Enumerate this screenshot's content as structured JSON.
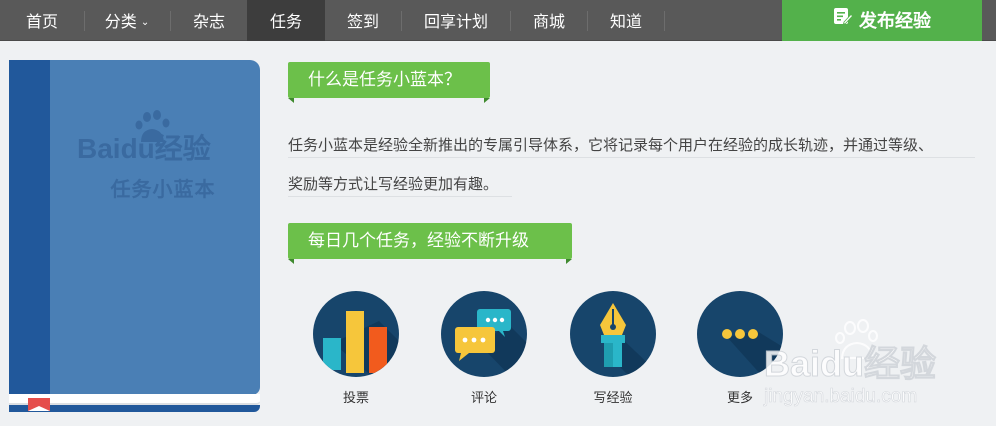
{
  "nav": {
    "items": [
      {
        "label": "首页",
        "active": false
      },
      {
        "label": "分类",
        "active": false,
        "has_dropdown": true
      },
      {
        "label": "杂志",
        "active": false
      },
      {
        "label": "任务",
        "active": true
      },
      {
        "label": "签到",
        "active": false
      },
      {
        "label": "回享计划",
        "active": false
      },
      {
        "label": "商城",
        "active": false
      },
      {
        "label": "知道",
        "active": false
      }
    ],
    "dropdown_icon": "chevron-down-icon",
    "publish_button": {
      "label": "发布经验",
      "icon": "edit-icon"
    }
  },
  "book": {
    "logo": "Baidu经验",
    "title": "任务小蓝本"
  },
  "section1": {
    "heading": "什么是任务小蓝本？",
    "description_lines": [
      "任务小蓝本是经验全新推出的专属引导体系，它将记录每个用户在经验的成长轨迹，并通过等级、",
      "奖励等方式让写经验更加有趣。"
    ]
  },
  "section2": {
    "heading": "每日几个任务，经验不断升级",
    "tasks": [
      {
        "label": "投票",
        "icon": "bar-chart-icon"
      },
      {
        "label": "评论",
        "icon": "chat-bubbles-icon"
      },
      {
        "label": "写经验",
        "icon": "fountain-pen-icon"
      },
      {
        "label": "更多",
        "icon": "more-dots-icon"
      }
    ]
  },
  "watermark": {
    "brand": "Baidu经验",
    "url": "jingyan.baidu.com"
  },
  "colors": {
    "nav_bg": "#595959",
    "nav_active": "#3d3d3d",
    "accent_green": "#53b14b",
    "ribbon_green": "#6cc04a",
    "book_blue": "#4a7fb5",
    "book_spine": "#21589b",
    "icon_circle": "#17456b"
  }
}
